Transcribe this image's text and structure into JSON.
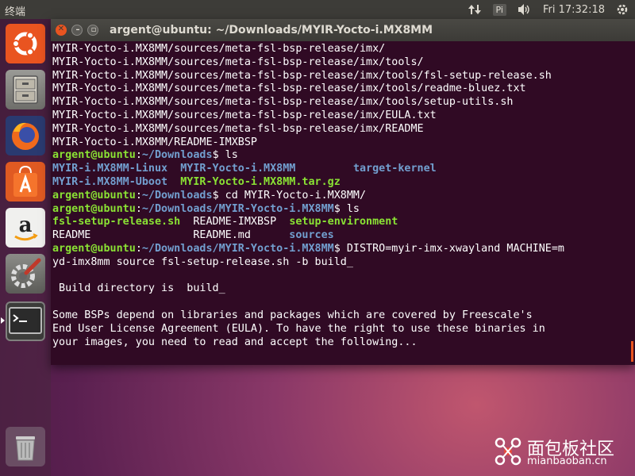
{
  "topbar": {
    "app_name": "终端",
    "keyboard_indicator": "Pi",
    "clock": "Fri 17:32:18"
  },
  "launcher": {
    "items": [
      {
        "name": "Ubuntu Dash"
      },
      {
        "name": "Files"
      },
      {
        "name": "Firefox"
      },
      {
        "name": "Ubuntu Software"
      },
      {
        "name": "Amazon"
      },
      {
        "name": "System Settings"
      },
      {
        "name": "Terminal"
      },
      {
        "name": "Trash"
      }
    ]
  },
  "terminal": {
    "title": "argent@ubuntu: ~/Downloads/MYIR-Yocto-i.MX8MM",
    "prompt_user": "argent@ubuntu",
    "lines": [
      [
        {
          "t": "MYIR-Yocto-i.MX8MM/sources/meta-fsl-bsp-release/imx/",
          "c": "w"
        }
      ],
      [
        {
          "t": "MYIR-Yocto-i.MX8MM/sources/meta-fsl-bsp-release/imx/tools/",
          "c": "w"
        }
      ],
      [
        {
          "t": "MYIR-Yocto-i.MX8MM/sources/meta-fsl-bsp-release/imx/tools/fsl-setup-release.sh",
          "c": "w"
        }
      ],
      [
        {
          "t": "MYIR-Yocto-i.MX8MM/sources/meta-fsl-bsp-release/imx/tools/readme-bluez.txt",
          "c": "w"
        }
      ],
      [
        {
          "t": "MYIR-Yocto-i.MX8MM/sources/meta-fsl-bsp-release/imx/tools/setup-utils.sh",
          "c": "w"
        }
      ],
      [
        {
          "t": "MYIR-Yocto-i.MX8MM/sources/meta-fsl-bsp-release/imx/EULA.txt",
          "c": "w"
        }
      ],
      [
        {
          "t": "MYIR-Yocto-i.MX8MM/sources/meta-fsl-bsp-release/imx/README",
          "c": "w"
        }
      ],
      [
        {
          "t": "MYIR-Yocto-i.MX8MM/README-IMXBSP",
          "c": "w"
        }
      ],
      [
        {
          "t": "argent@ubuntu",
          "c": "g"
        },
        {
          "t": ":",
          "c": "w"
        },
        {
          "t": "~/Downloads",
          "c": "b"
        },
        {
          "t": "$ ls",
          "c": "w"
        }
      ],
      [
        {
          "t": "MYIR-i.MX8MM-Linux",
          "c": "b"
        },
        {
          "t": "  ",
          "c": "w"
        },
        {
          "t": "MYIR-Yocto-i.MX8MM",
          "c": "b"
        },
        {
          "t": "         ",
          "c": "w"
        },
        {
          "t": "target-kernel",
          "c": "b"
        }
      ],
      [
        {
          "t": "MYIR-i.MX8MM-Uboot",
          "c": "b"
        },
        {
          "t": "  ",
          "c": "w"
        },
        {
          "t": "MYIR-Yocto-i.MX8MM.tar.gz",
          "c": "g"
        }
      ],
      [
        {
          "t": "argent@ubuntu",
          "c": "g"
        },
        {
          "t": ":",
          "c": "w"
        },
        {
          "t": "~/Downloads",
          "c": "b"
        },
        {
          "t": "$ cd MYIR-Yocto-i.MX8MM/",
          "c": "w"
        }
      ],
      [
        {
          "t": "argent@ubuntu",
          "c": "g"
        },
        {
          "t": ":",
          "c": "w"
        },
        {
          "t": "~/Downloads/MYIR-Yocto-i.MX8MM",
          "c": "b"
        },
        {
          "t": "$ ls",
          "c": "w"
        }
      ],
      [
        {
          "t": "fsl-setup-release.sh",
          "c": "g"
        },
        {
          "t": "  README-IMXBSP  ",
          "c": "w"
        },
        {
          "t": "setup-environment",
          "c": "g"
        }
      ],
      [
        {
          "t": "README                README.md      ",
          "c": "w"
        },
        {
          "t": "sources",
          "c": "b"
        }
      ],
      [
        {
          "t": "argent@ubuntu",
          "c": "g"
        },
        {
          "t": ":",
          "c": "w"
        },
        {
          "t": "~/Downloads/MYIR-Yocto-i.MX8MM",
          "c": "b"
        },
        {
          "t": "$ DISTRO=myir-imx-xwayland MACHINE=m",
          "c": "w"
        }
      ],
      [
        {
          "t": "yd-imx8mm source fsl-setup-release.sh -b build_",
          "c": "w"
        }
      ],
      [
        {
          "t": "",
          "c": "w"
        }
      ],
      [
        {
          "t": " Build directory is  build_",
          "c": "w"
        }
      ],
      [
        {
          "t": "",
          "c": "w"
        }
      ],
      [
        {
          "t": "Some BSPs depend on libraries and packages which are covered by Freescale's",
          "c": "w"
        }
      ],
      [
        {
          "t": "End User License Agreement (EULA). To have the right to use these binaries in",
          "c": "w"
        }
      ],
      [
        {
          "t": "your images, you need to read and accept the following...",
          "c": "w"
        }
      ]
    ]
  },
  "watermark": {
    "text_cn": "面包板社区",
    "text_en": "mianbaoban.cn"
  },
  "colors": {
    "terminal_bg": "#300a24",
    "prompt_green": "#8ae234",
    "path_blue": "#729fcf",
    "accent_orange": "#e95420"
  }
}
